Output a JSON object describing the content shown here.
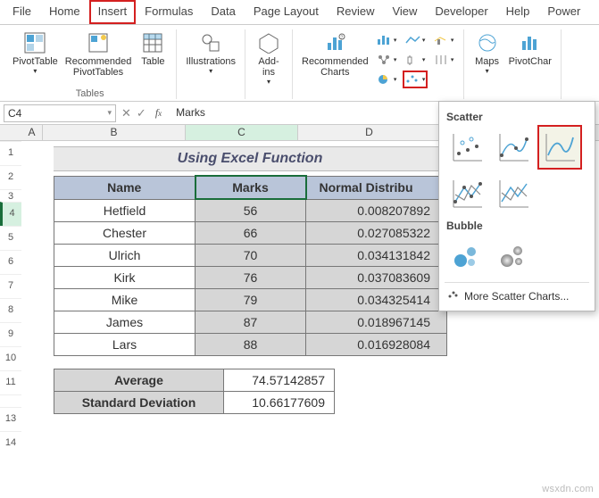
{
  "tabs": {
    "file": "File",
    "home": "Home",
    "insert": "Insert",
    "formulas": "Formulas",
    "data": "Data",
    "page_layout": "Page Layout",
    "review": "Review",
    "view": "View",
    "developer": "Developer",
    "help": "Help",
    "power": "Power"
  },
  "ribbon": {
    "tables_label": "Tables",
    "pivottable": "PivotTable",
    "recommended_pivot": "Recommended\nPivotTables",
    "table": "Table",
    "illustrations": "Illustrations",
    "addins": "Add-\nins",
    "recommended_charts": "Recommended\nCharts",
    "maps": "Maps",
    "pivotchart": "PivotChar"
  },
  "namebox": "C4",
  "formula": "Marks",
  "colA": "A",
  "colB": "B",
  "colC": "C",
  "colD": "D",
  "sheet_title": "Using Excel Function",
  "thead": {
    "name": "Name",
    "marks": "Marks",
    "nd": "Normal Distribu"
  },
  "rows": [
    {
      "name": "Hetfield",
      "marks": "56",
      "nd": "0.008207892"
    },
    {
      "name": "Chester",
      "marks": "66",
      "nd": "0.027085322"
    },
    {
      "name": "Ulrich",
      "marks": "70",
      "nd": "0.034131842"
    },
    {
      "name": "Kirk",
      "marks": "76",
      "nd": "0.037083609"
    },
    {
      "name": "Mike",
      "marks": "79",
      "nd": "0.034325414"
    },
    {
      "name": "James",
      "marks": "87",
      "nd": "0.018967145"
    },
    {
      "name": "Lars",
      "marks": "88",
      "nd": "0.016928084"
    }
  ],
  "stats": {
    "avg_k": "Average",
    "avg_v": "74.57142857",
    "std_k": "Standard Deviation",
    "std_v": "10.66177609"
  },
  "popup": {
    "scatter": "Scatter",
    "bubble": "Bubble",
    "more": "More Scatter Charts..."
  },
  "rownums": [
    "1",
    "2",
    "3",
    "4",
    "5",
    "6",
    "7",
    "8",
    "9",
    "10",
    "11",
    "",
    "13",
    "14"
  ],
  "watermark": "wsxdn.com"
}
